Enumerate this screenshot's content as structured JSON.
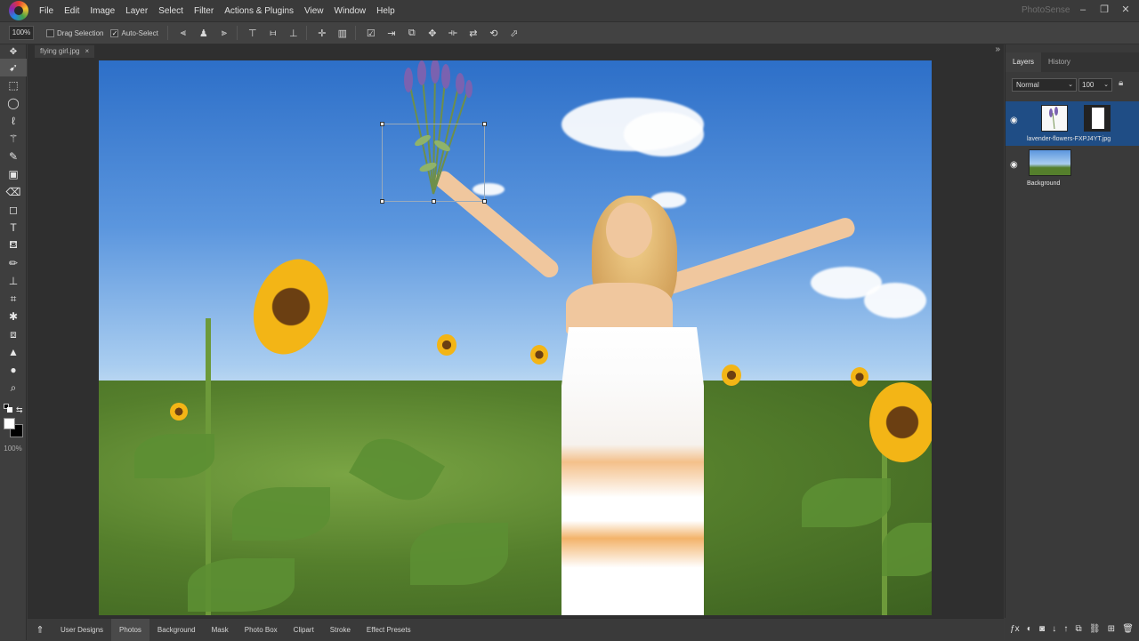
{
  "menubar": {
    "items": [
      "File",
      "Edit",
      "Image",
      "Layer",
      "Select",
      "Filter",
      "Actions & Plugins",
      "View",
      "Window",
      "Help"
    ],
    "brand": "PhotoSense"
  },
  "options": {
    "zoom": "100%",
    "drag_selection_label": "Drag Selection",
    "auto_select_label": "Auto-Select",
    "auto_select_checked": true
  },
  "toolbar": {
    "zoom_label": "100%"
  },
  "document": {
    "tab_title": "flying girl.jpg",
    "close_glyph": "×"
  },
  "panel": {
    "tabs": [
      "Layers",
      "History"
    ],
    "blend_mode": "Normal",
    "opacity": "100",
    "layers": [
      {
        "name": "lavender-flowers-FXPJ4YT.jpg"
      },
      {
        "name": "Background"
      }
    ]
  },
  "bottom_bar": {
    "items": [
      "User Designs",
      "Photos",
      "Background",
      "Mask",
      "Photo Box",
      "Clipart",
      "Stroke",
      "Effect Presets"
    ],
    "active": "Photos"
  }
}
